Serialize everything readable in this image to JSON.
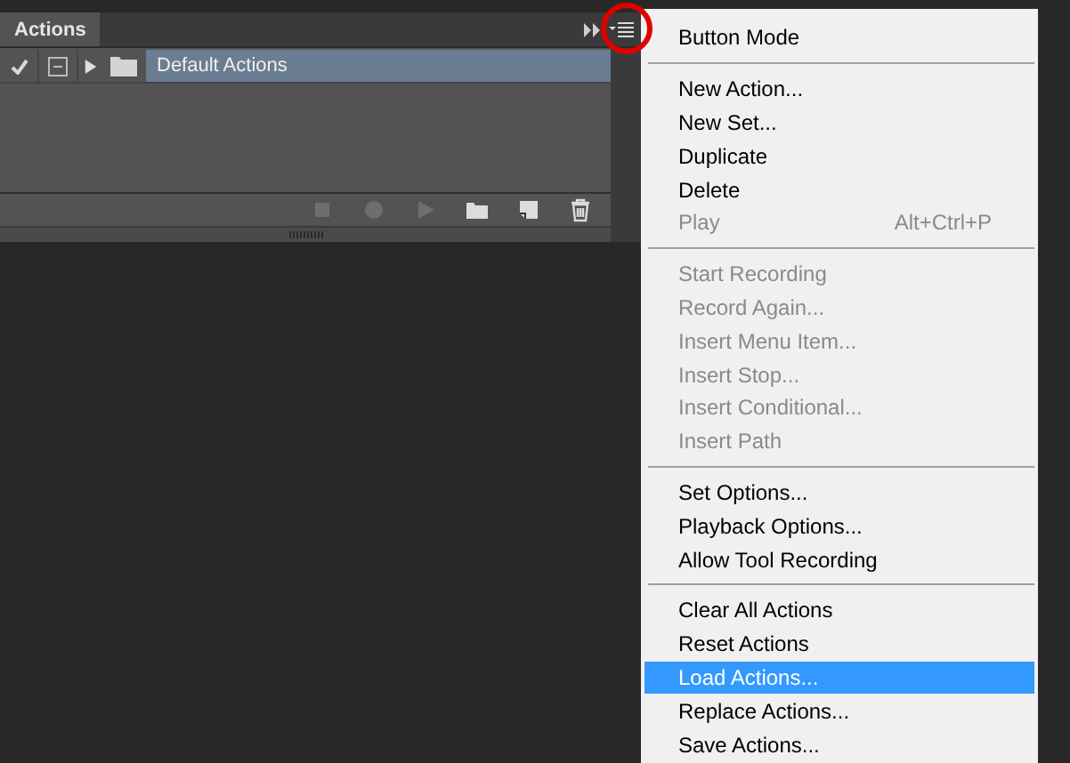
{
  "panel": {
    "tab": "Actions",
    "rows": [
      {
        "checked": true,
        "expanded": false,
        "selected": true,
        "name": "Default Actions"
      }
    ],
    "footer_buttons": [
      {
        "kind": "stop",
        "disabled": true
      },
      {
        "kind": "record",
        "disabled": true
      },
      {
        "kind": "play",
        "disabled": true
      },
      {
        "kind": "folder",
        "disabled": false
      },
      {
        "kind": "new",
        "disabled": false
      },
      {
        "kind": "delete",
        "disabled": false
      }
    ]
  },
  "menu": {
    "sections": [
      [
        {
          "label": "Button Mode",
          "disabled": false,
          "selected": false
        }
      ],
      [
        {
          "label": "New Action...",
          "disabled": false,
          "selected": false
        },
        {
          "label": "New Set...",
          "disabled": false,
          "selected": false
        },
        {
          "label": "Duplicate",
          "disabled": false,
          "selected": false
        },
        {
          "label": "Delete",
          "disabled": false,
          "selected": false
        },
        {
          "label": "Play",
          "shortcut": "Alt+Ctrl+P",
          "disabled": true,
          "selected": false
        }
      ],
      [
        {
          "label": "Start Recording",
          "disabled": true,
          "selected": false
        },
        {
          "label": "Record Again...",
          "disabled": true,
          "selected": false
        },
        {
          "label": "Insert Menu Item...",
          "disabled": true,
          "selected": false
        },
        {
          "label": "Insert Stop...",
          "disabled": true,
          "selected": false
        },
        {
          "label": "Insert Conditional...",
          "disabled": true,
          "selected": false
        },
        {
          "label": "Insert Path",
          "disabled": true,
          "selected": false
        }
      ],
      [
        {
          "label": "Set Options...",
          "disabled": false,
          "selected": false
        },
        {
          "label": "Playback Options...",
          "disabled": false,
          "selected": false
        },
        {
          "label": "Allow Tool Recording",
          "disabled": false,
          "selected": false
        }
      ],
      [
        {
          "label": "Clear All Actions",
          "disabled": false,
          "selected": false
        },
        {
          "label": "Reset Actions",
          "disabled": false,
          "selected": false
        },
        {
          "label": "Load Actions...",
          "disabled": false,
          "selected": true
        },
        {
          "label": "Replace Actions...",
          "disabled": false,
          "selected": false
        },
        {
          "label": "Save Actions...",
          "disabled": false,
          "selected": false
        }
      ]
    ]
  }
}
